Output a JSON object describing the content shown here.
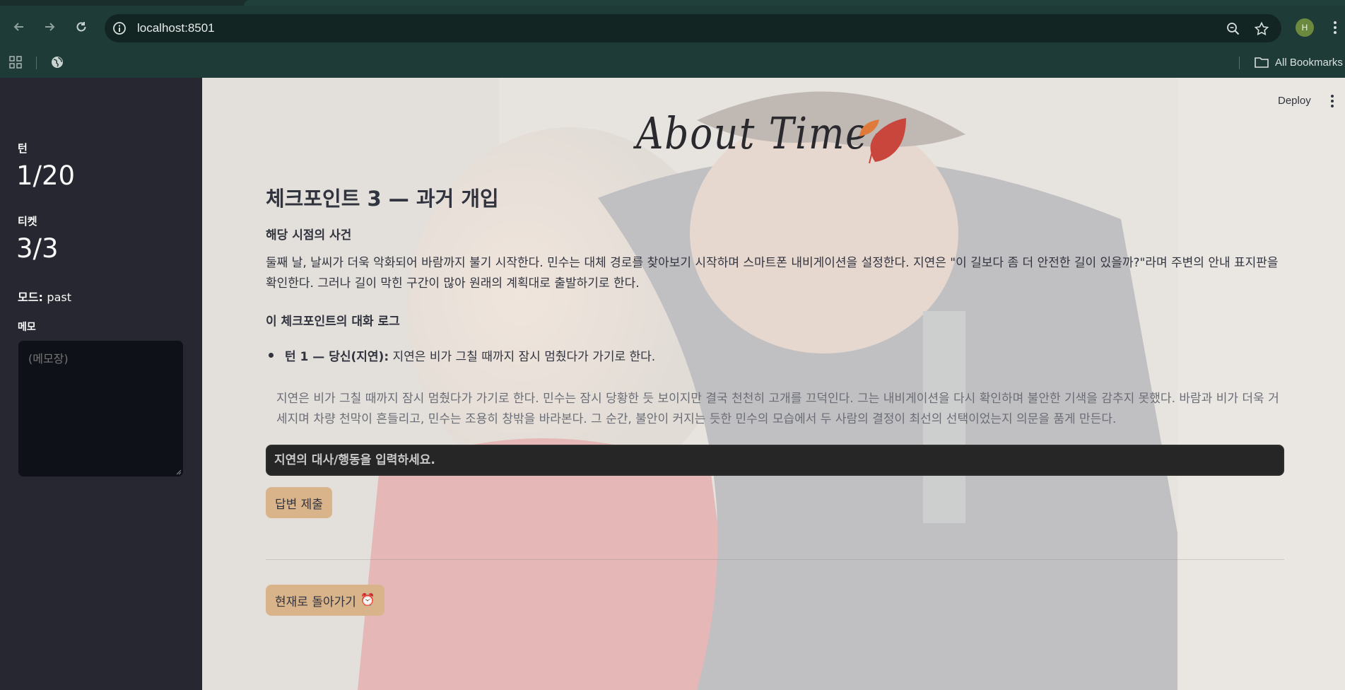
{
  "browser": {
    "url": "localhost:8501",
    "profile_initial": "H",
    "bookmarks_label": "All Bookmarks"
  },
  "sidebar": {
    "turn_label": "턴",
    "turn_value": "1/20",
    "ticket_label": "티켓",
    "ticket_value": "3/3",
    "mode_label": "모드:",
    "mode_value": "past",
    "memo_label": "메모",
    "memo_placeholder": "(메모장)"
  },
  "header": {
    "deploy_label": "Deploy"
  },
  "main": {
    "app_title": "About Time",
    "checkpoint_title": "체크포인트 3 — 과거 개입",
    "event_heading": "해당 시점의 사건",
    "event_text": "둘째 날, 날씨가 더욱 악화되어 바람까지 불기 시작한다. 민수는 대체 경로를 찾아보기 시작하며 스마트폰 내비게이션을 설정한다. 지연은 \"이 길보다 좀 더 안전한 길이 있을까?\"라며 주변의 안내 표지판을 확인한다. 그러나 길이 막힌 구간이 많아 원래의 계획대로 출발하기로 한다.",
    "log_heading": "이 체크포인트의 대화 로그",
    "log_items": [
      {
        "speaker": "턴 1 — 당신(지연):",
        "text": " 지연은 비가 그칠 때까지 잠시 멈췄다가 가기로 한다."
      }
    ],
    "ai_response": "지연은 비가 그칠 때까지 잠시 멈췄다가 가기로 한다. 민수는 잠시 당황한 듯 보이지만 결국 천천히 고개를 끄덕인다. 그는 내비게이션을 다시 확인하며 불안한 기색을 감추지 못했다. 바람과 비가 더욱 거세지며 차량 천막이 흔들리고, 민수는 조용히 창밖을 바라본다. 그 순간, 불안이 커지는 듯한 민수의 모습에서 두 사람의 결정이 최선의 선택이었는지 의문을 품게 만든다.",
    "input_placeholder": "지연의 대사/행동을 입력하세요.",
    "submit_label": "답변 제출",
    "return_label": "현재로 돌아가기",
    "return_icon": "⏰"
  },
  "colors": {
    "sidebar_bg": "#262730",
    "button_bg": "#d9b48a",
    "input_bg": "#262626",
    "browser_bg": "#1f3b38"
  }
}
